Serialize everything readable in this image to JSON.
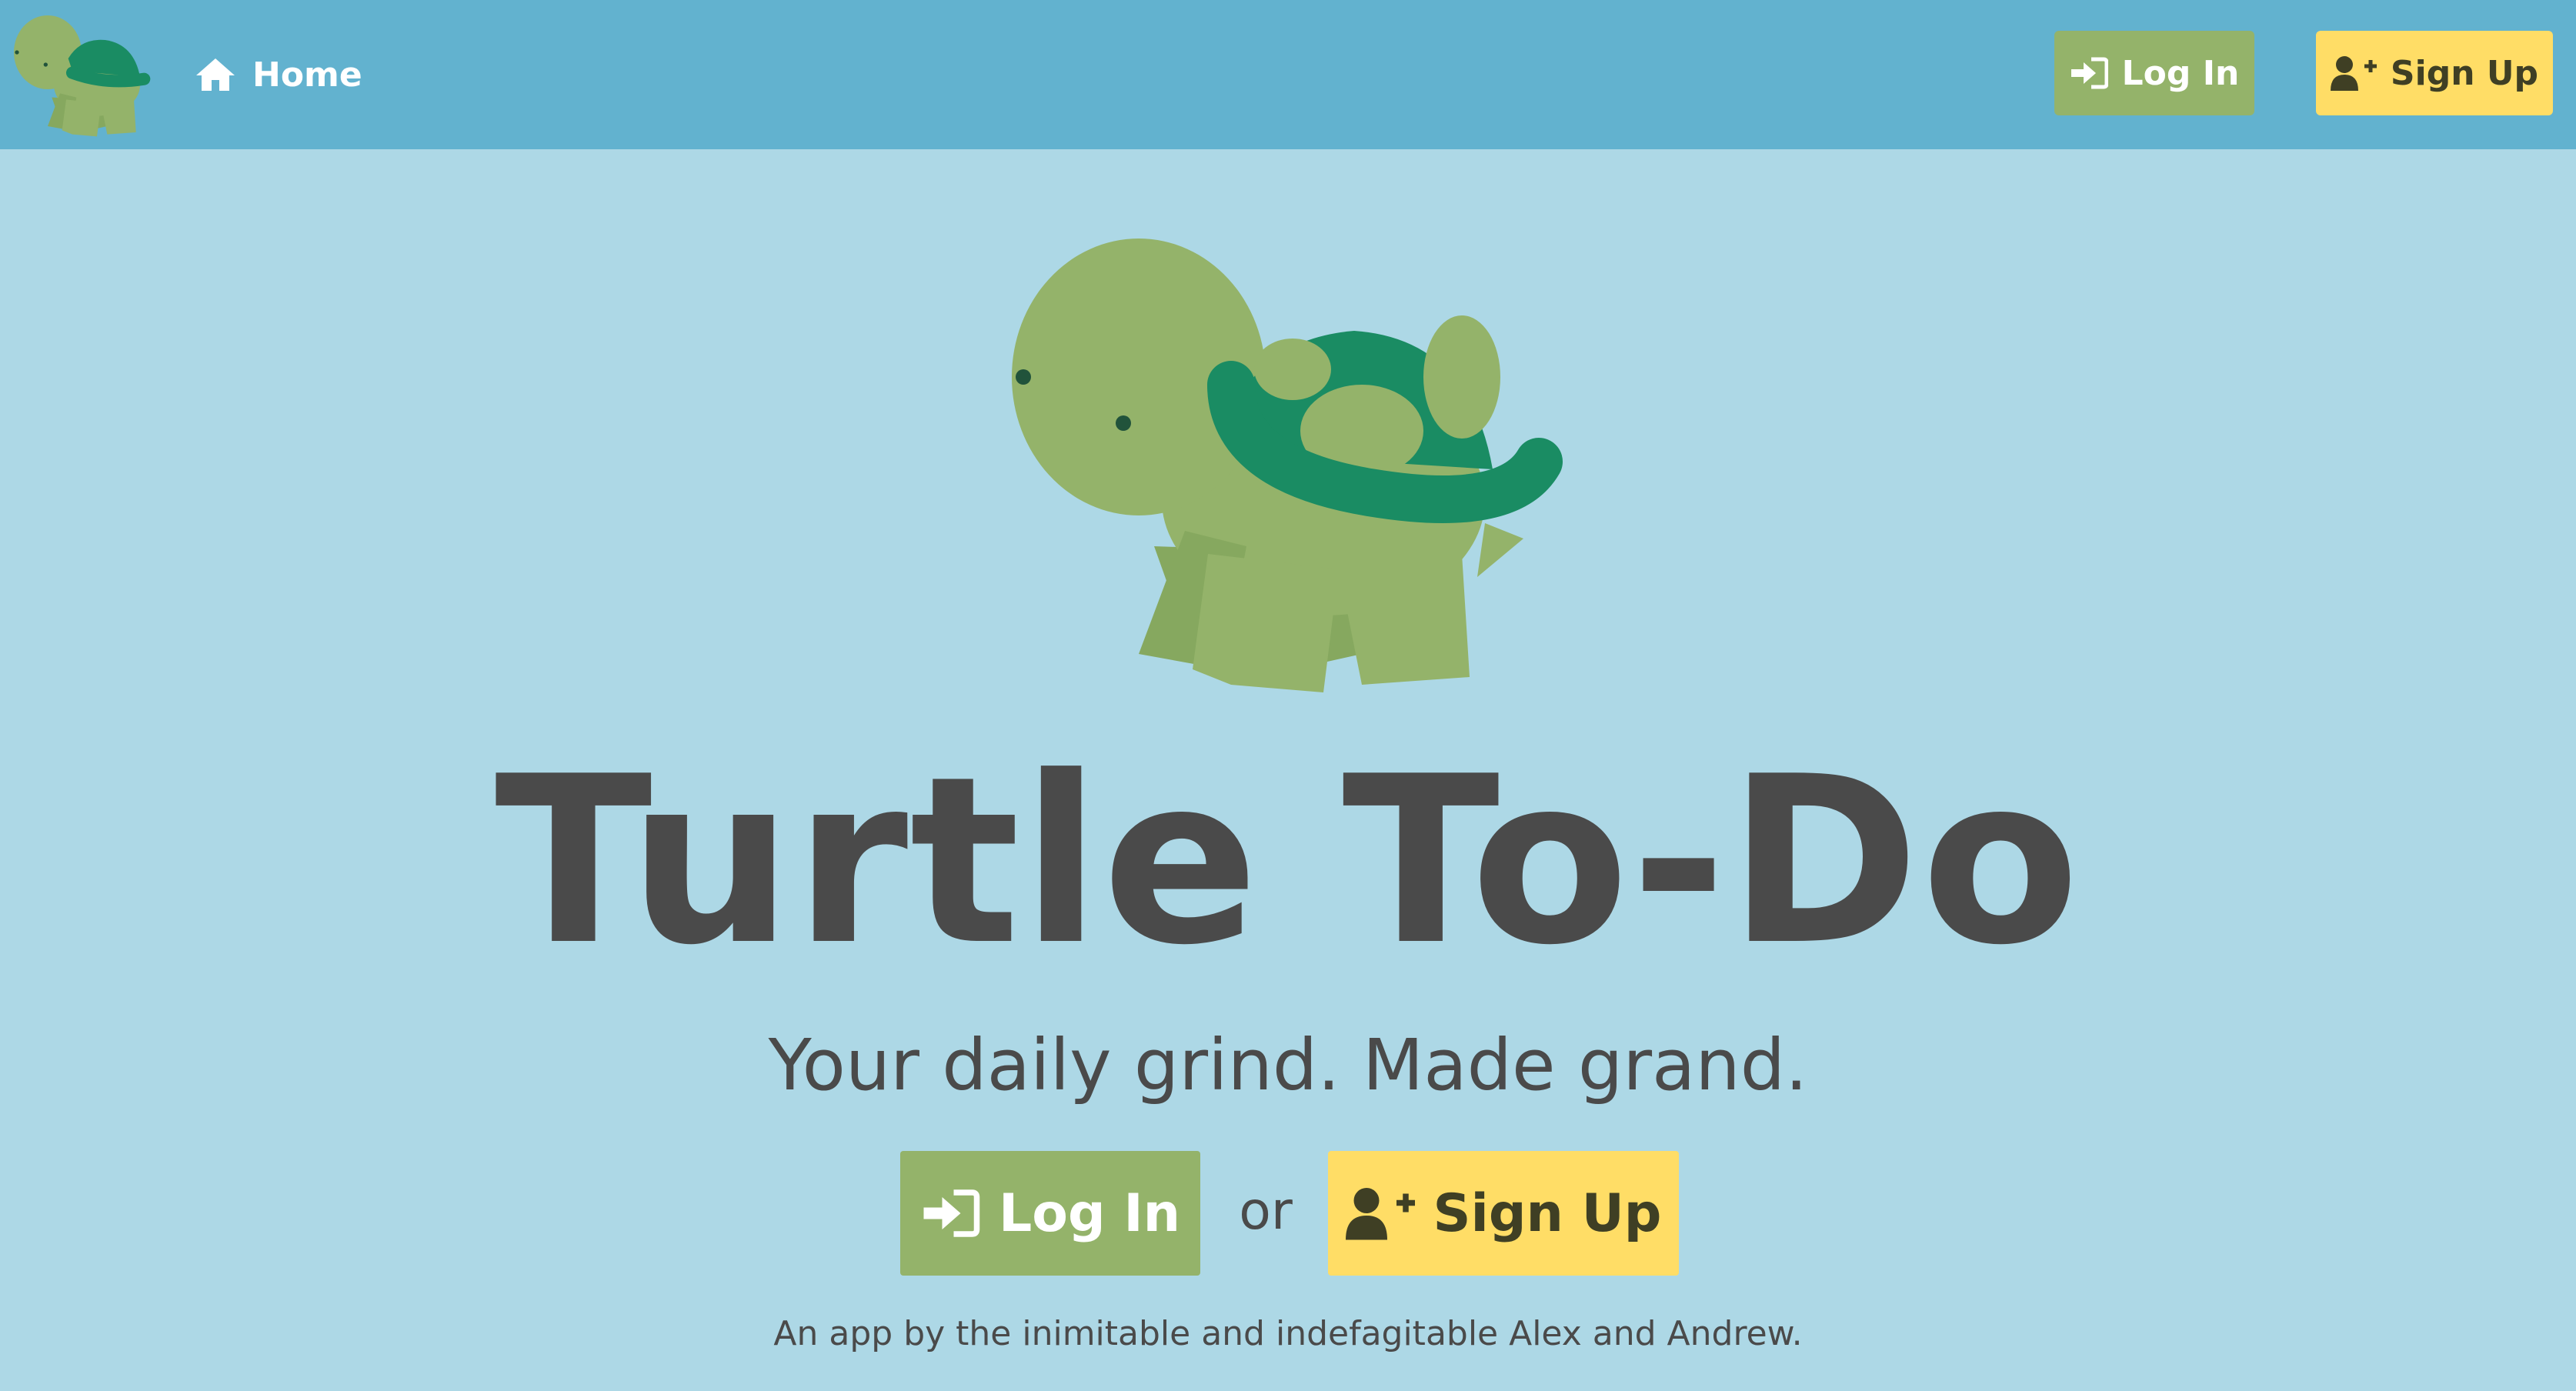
{
  "navbar": {
    "logo_icon": "turtle-logo-icon",
    "home_label": "Home",
    "home_icon": "home-icon",
    "login_label": "Log In",
    "login_icon": "sign-in-icon",
    "signup_label": "Sign Up",
    "signup_icon": "user-plus-icon"
  },
  "hero": {
    "illustration": "turtle-illustration",
    "title": "Turtle To-Do",
    "tagline": "Your daily grind. Made grand.",
    "login_label": "Log In",
    "or_label": "or",
    "signup_label": "Sign Up",
    "credit": "An app by the inimitable and indefagitable Alex and Andrew."
  },
  "colors": {
    "navbar_bg": "#62b2cf",
    "page_bg": "#add8e6",
    "login_button": "#94b36a",
    "signup_button": "#ffdd66",
    "text_dark": "#4a4a4a",
    "turtle_body": "#94b36a",
    "turtle_shell": "#1a8c63"
  }
}
